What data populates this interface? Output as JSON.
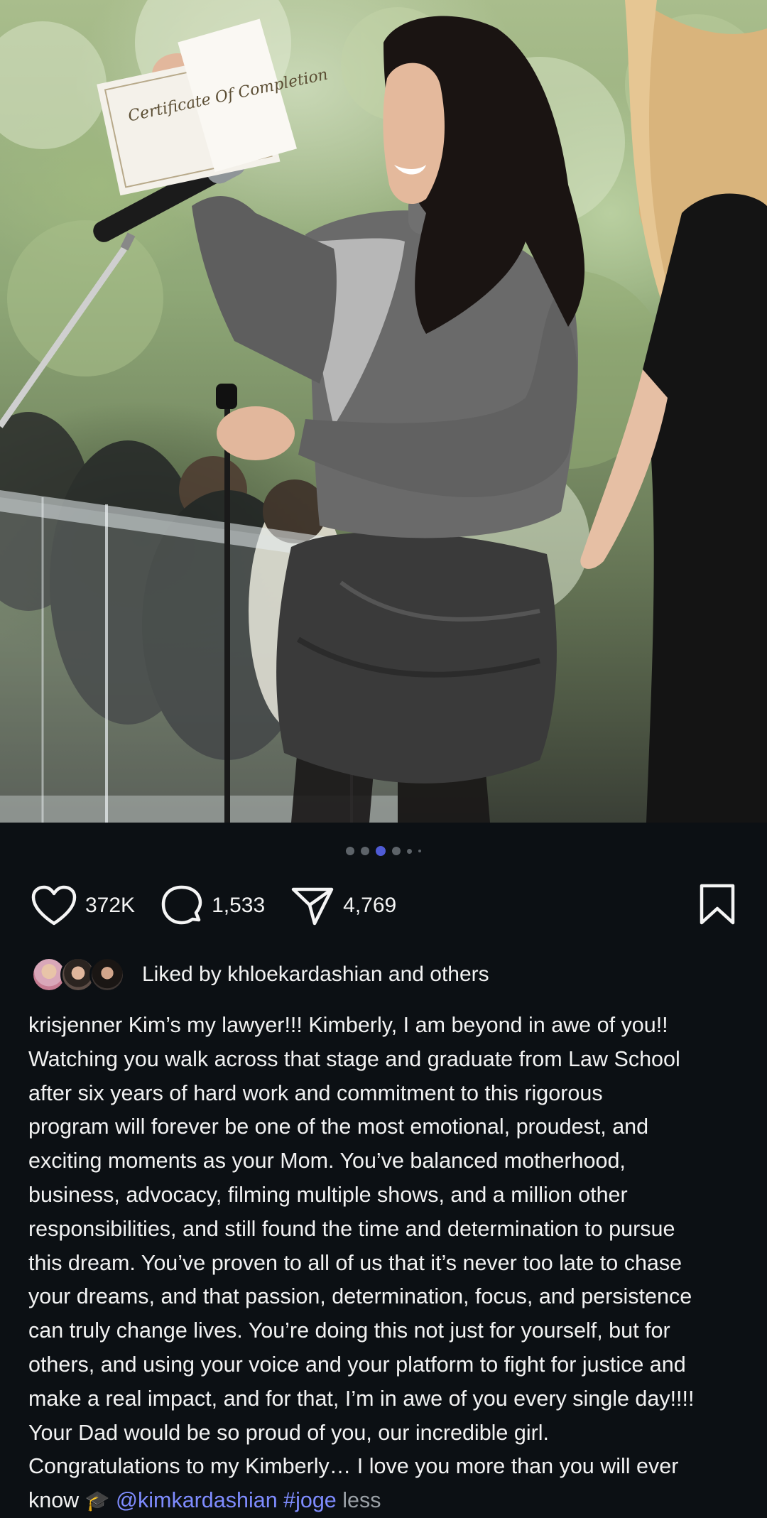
{
  "post": {
    "carousel": {
      "total_dots": 6,
      "active_index": 2
    },
    "actions": {
      "likes": "372K",
      "comments": "1,533",
      "shares": "4,769"
    },
    "liked_by": {
      "text": "Liked by khloekardashian and others"
    },
    "caption": {
      "username": "krisjenner",
      "lines": [
        "Kim’s my lawyer!!! Kimberly, I am beyond in awe of you!!",
        "Watching you walk across that stage and graduate from Law School",
        "after six years of hard work and commitment to this rigorous",
        "program will forever be one of the most emotional, proudest, and",
        "exciting moments as your Mom. You’ve balanced motherhood,",
        "business, advocacy, filming multiple shows, and a million other",
        "responsibilities, and still found the time and determination to pursue",
        "this dream. You’ve proven to all of us that it’s never too late to chase",
        "your dreams, and that passion, determination, focus, and persistence",
        "can truly change lives. You’re doing this not just for yourself, but for",
        "others, and using your voice and your platform to fight for justice and",
        "make a real impact, and for that, I’m in awe of you every single day!!!!",
        "Your Dad would be so proud of you, our incredible girl.",
        "Congratulations to my Kimberly… I love you more than you will ever"
      ],
      "last_line_text": "know",
      "emoji": "🎓",
      "mention": "@kimkardashian",
      "hashtag": "#joge",
      "less_label": "less"
    },
    "photo": {
      "certificate_text": "Certificate Of Completion"
    }
  },
  "colors": {
    "background": "#0c1014",
    "link": "#7f8cff",
    "active_dot": "#4f5bd5",
    "muted": "#9aa0a6"
  }
}
